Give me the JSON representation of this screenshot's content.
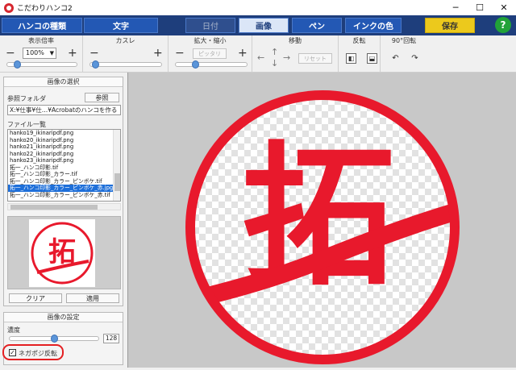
{
  "window": {
    "title": "こだわりハンコ2",
    "minimize": "─",
    "maximize": "☐",
    "close": "✕"
  },
  "toolbar": {
    "hanko_type": "ハンコの種類",
    "text": "文字",
    "date": "日付",
    "image": "画像",
    "pen": "ペン",
    "ink_color": "インクの色",
    "save": "保存",
    "help": "?"
  },
  "options": {
    "zoom": {
      "label": "表示倍率",
      "value": "100%",
      "minus": "−",
      "plus": "+",
      "level": 0.1
    },
    "blur": {
      "label": "カスレ",
      "minus": "−",
      "plus": "+",
      "level": 0.02
    },
    "scale": {
      "label": "拡大・縮小",
      "minus": "−",
      "plus": "+",
      "fit": "ピッタリ",
      "level": 0.25
    },
    "move": {
      "label": "移動",
      "reset": "リセット",
      "left": "←",
      "right": "→",
      "up": "↑",
      "down": "↓"
    },
    "flip": {
      "label": "反転"
    },
    "rotate": {
      "label": "90°回転"
    }
  },
  "image_select": {
    "title": "画像の選択",
    "folder_label": "参照フォルダ",
    "browse_button": "参照",
    "folder_path": "X:¥仕事¥仕…¥Acrobatのハンコを作る",
    "file_list_label": "ファイル一覧",
    "files": [
      "hanko19_ikinaripdf.png",
      "hanko20_ikinaripdf.png",
      "hanko21_ikinaripdf.png",
      "hanko22_ikinaripdf.png",
      "hanko23_ikinaripdf.png",
      "拓一_ハンコ印影.tif",
      "拓一_ハンコ印影_カラー.tif",
      "拓一_ハンコ印影_カラー_ピンボケ.tif",
      "拓一_ハンコ印影_カラー_ピンボケ_赤.jpg",
      "拓一_ハンコ印影_カラー_ピンボケ_赤.tif"
    ],
    "selected_index": 8,
    "clear_button": "クリア",
    "apply_button": "適用",
    "preview_char": "拓"
  },
  "image_settings": {
    "title": "画像の設定",
    "density_label": "濃度",
    "density_value": "128",
    "density_level": 0.5,
    "negapoji_label": "ネガポジ反転",
    "negapoji_checked": "✓"
  },
  "stamp": {
    "char": "拓",
    "color": "#e8192c"
  },
  "colors": {
    "toolbar_bg": "#1e3e7c",
    "accent": "#2358b4",
    "save": "#ecc91c",
    "help": "#21a238"
  }
}
